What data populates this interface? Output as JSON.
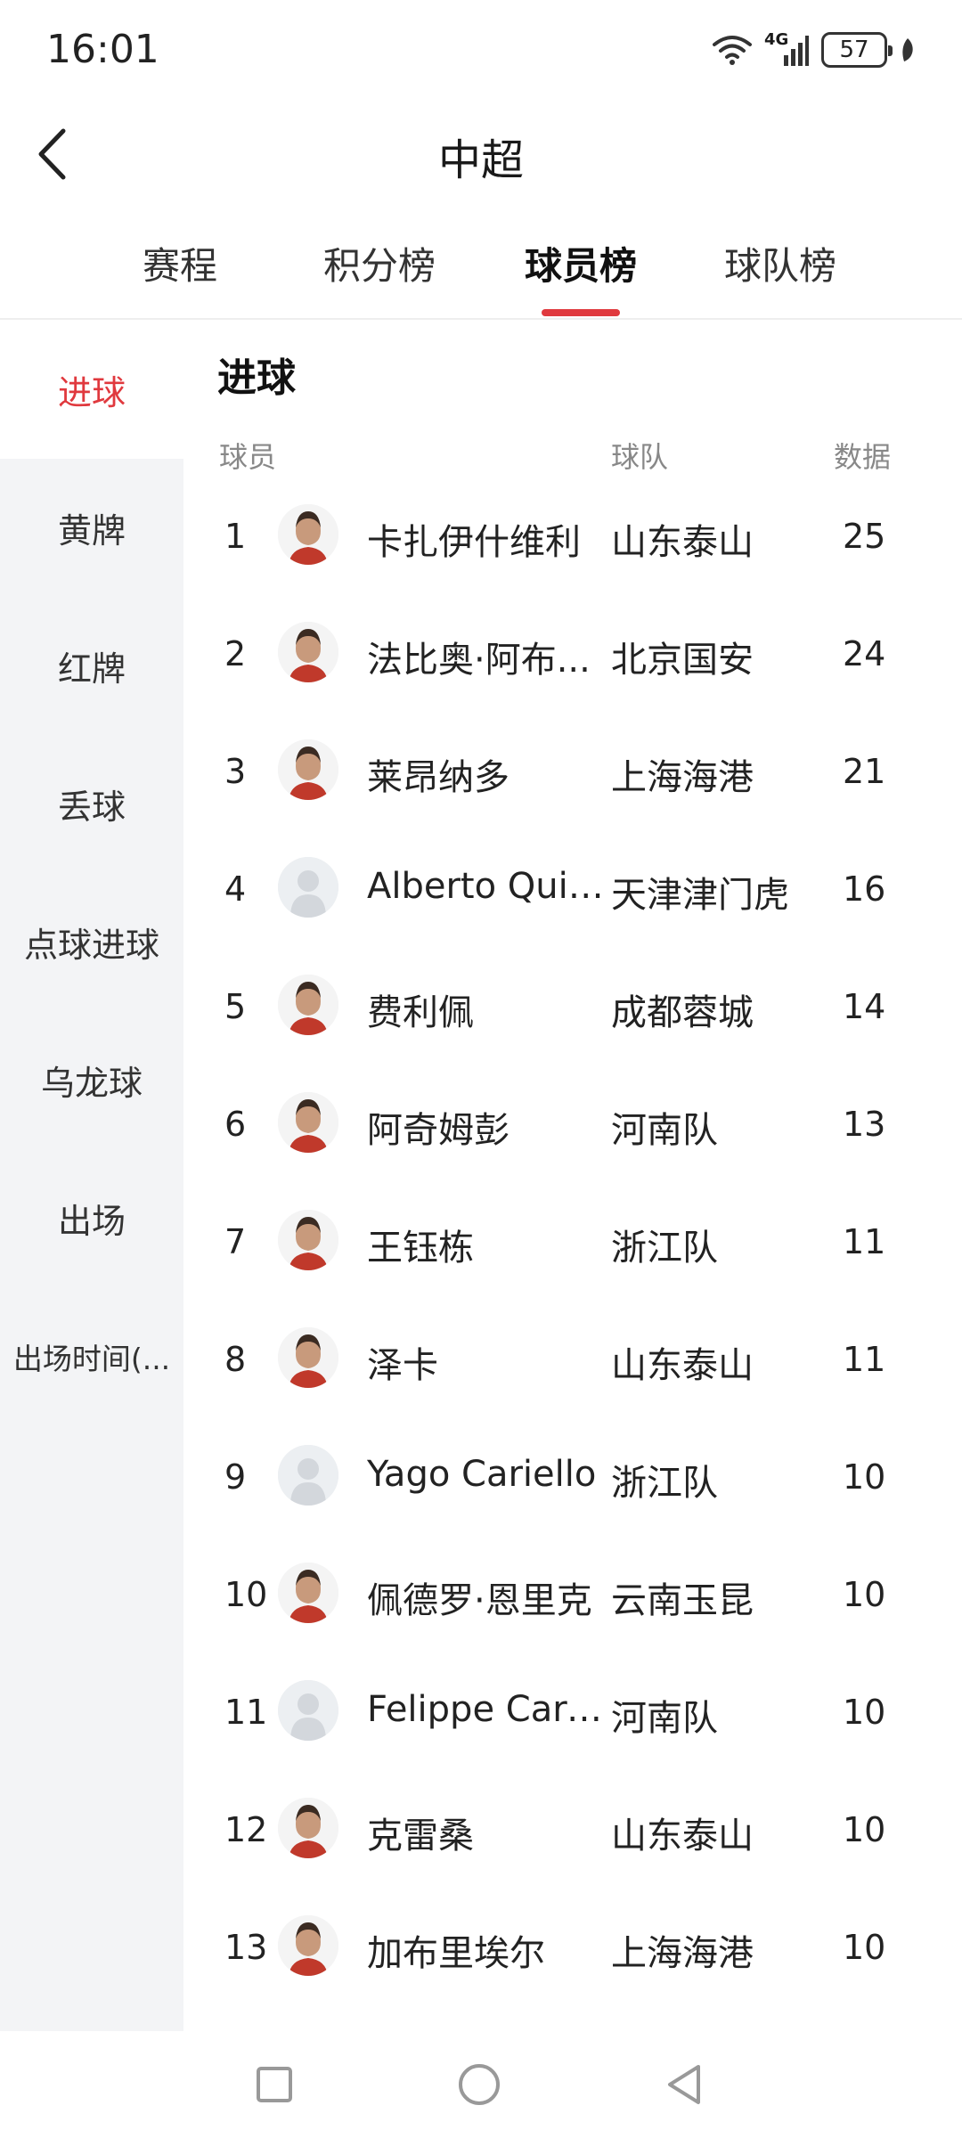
{
  "status_bar": {
    "time": "16:01",
    "network": "4G",
    "battery": "57"
  },
  "header": {
    "title": "中超"
  },
  "tabs": [
    {
      "label": "赛程",
      "active": false
    },
    {
      "label": "积分榜",
      "active": false
    },
    {
      "label": "球员榜",
      "active": true
    },
    {
      "label": "球队榜",
      "active": false
    }
  ],
  "sidebar": {
    "items": [
      {
        "label": "进球",
        "active": true
      },
      {
        "label": "黄牌",
        "active": false
      },
      {
        "label": "红牌",
        "active": false
      },
      {
        "label": "丢球",
        "active": false
      },
      {
        "label": "点球进球",
        "active": false
      },
      {
        "label": "乌龙球",
        "active": false
      },
      {
        "label": "出场",
        "active": false
      },
      {
        "label": "出场时间(...",
        "active": false
      }
    ]
  },
  "main": {
    "section_title": "进球",
    "columns": {
      "player": "球员",
      "team": "球队",
      "data": "数据"
    },
    "rows": [
      {
        "rank": "1",
        "name": "卡扎伊什维利",
        "team": "山东泰山",
        "value": "25",
        "avatar": "player-photo"
      },
      {
        "rank": "2",
        "name": "法比奥·阿布...",
        "team": "北京国安",
        "value": "24",
        "avatar": "player-photo"
      },
      {
        "rank": "3",
        "name": "莱昂纳多",
        "team": "上海海港",
        "value": "21",
        "avatar": "player-photo"
      },
      {
        "rank": "4",
        "name": "Alberto Quiles",
        "team": "天津津门虎",
        "value": "16",
        "avatar": "placeholder"
      },
      {
        "rank": "5",
        "name": "费利佩",
        "team": "成都蓉城",
        "value": "14",
        "avatar": "player-photo"
      },
      {
        "rank": "6",
        "name": "阿奇姆彭",
        "team": "河南队",
        "value": "13",
        "avatar": "player-photo"
      },
      {
        "rank": "7",
        "name": "王钰栋",
        "team": "浙江队",
        "value": "11",
        "avatar": "player-photo"
      },
      {
        "rank": "8",
        "name": "泽卡",
        "team": "山东泰山",
        "value": "11",
        "avatar": "player-photo"
      },
      {
        "rank": "9",
        "name": "Yago Cariello",
        "team": "浙江队",
        "value": "10",
        "avatar": "placeholder"
      },
      {
        "rank": "10",
        "name": "佩德罗·恩里克",
        "team": "云南玉昆",
        "value": "10",
        "avatar": "player-photo"
      },
      {
        "rank": "11",
        "name": "Felippe Card...",
        "team": "河南队",
        "value": "10",
        "avatar": "placeholder"
      },
      {
        "rank": "12",
        "name": "克雷桑",
        "team": "山东泰山",
        "value": "10",
        "avatar": "player-photo"
      },
      {
        "rank": "13",
        "name": "加布里埃尔",
        "team": "上海海港",
        "value": "10",
        "avatar": "player-photo"
      }
    ]
  },
  "nav_bar": {
    "icons": [
      "recents-square-icon",
      "home-circle-icon",
      "back-triangle-icon"
    ]
  },
  "colors": {
    "accent": "#e0393e",
    "sidebar_bg": "#f3f4f6",
    "muted_text": "#888888"
  }
}
